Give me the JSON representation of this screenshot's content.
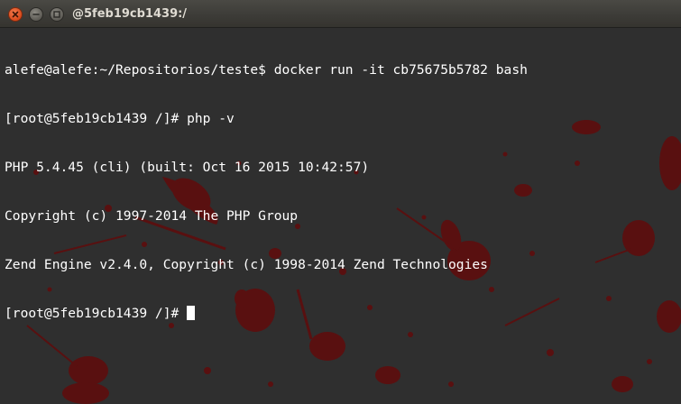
{
  "window": {
    "title": "@5feb19cb1439:/"
  },
  "terminal": {
    "lines": [
      "alefe@alefe:~/Repositorios/teste$ docker run -it cb75675b5782 bash",
      "[root@5feb19cb1439 /]# php -v",
      "PHP 5.4.45 (cli) (built: Oct 16 2015 10:42:57)",
      "Copyright (c) 1997-2014 The PHP Group",
      "Zend Engine v2.4.0, Copyright (c) 1998-2014 Zend Technologies",
      "[root@5feb19cb1439 /]# "
    ],
    "colors": {
      "background": "#2f2f2f",
      "text": "#ffffff",
      "splatter": "#5c0f0f"
    },
    "background_image": "dark grey with dark red blood splatter"
  }
}
